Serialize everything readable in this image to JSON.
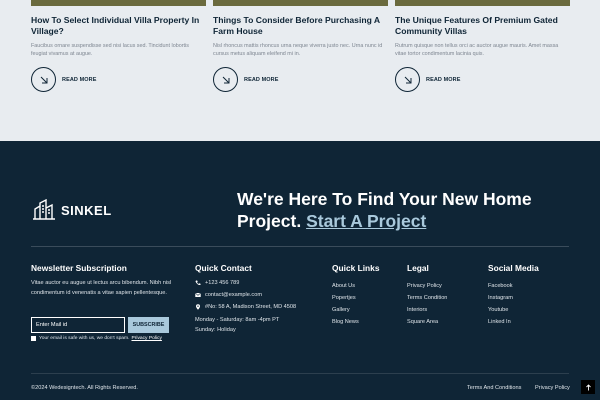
{
  "blog": {
    "cards": [
      {
        "title": "How To Select Individual Villa Property In Village?",
        "desc": "Faucibus ornare suspendisse sed nisi lacus sed. Tincidunt lobortis feugiat vivamus at augue.",
        "more": "READ MORE"
      },
      {
        "title": "Things To Consider Before Purchasing A Farm House",
        "desc": "Nisl rhoncus mattis rhoncus urna neque viverra justo nec. Urna nunc id cursus metus aliquam eleifend mi in.",
        "more": "READ MORE"
      },
      {
        "title": "The Unique Features Of Premium Gated Community Villas",
        "desc": "Rutrum quisque non tellus orci ac auctor augue mauris. Amet massa vitae tortor condimentum lacinia quis.",
        "more": "READ MORE"
      }
    ]
  },
  "footer": {
    "logo": "SINKEL",
    "hero_line1": "We're Here To Find Your New Home",
    "hero_line2": "Project.",
    "hero_cta": "Start A Project",
    "newsletter": {
      "title": "Newsletter Subscription",
      "text": "Vitae auctor eu augue ut lectus arcu bibendum. Nibh nisl condimentum id venenatis a vitae sapien pellentesque.",
      "placeholder": "Enter Mail id",
      "button": "SUBSCRIBE",
      "consent": "Your email is safe with us, we don't spam.",
      "privacy_link": "Privacy Policy"
    },
    "contact": {
      "title": "Quick Contact",
      "phone": "+123 456 789",
      "email": "contact@example.com",
      "address": "#No: 58 A, Madison Street, MD 4508",
      "hours_line1": "Monday - Saturday: 8am -4pm PT",
      "hours_line2": "Sunday: Holiday"
    },
    "quick_links": {
      "title": "Quick Links",
      "items": [
        "About Us",
        "Popertjes",
        "Gallery",
        "Blog News"
      ]
    },
    "legal": {
      "title": "Legal",
      "items": [
        "Privacy Policy",
        "Terms Condition",
        "Interiors",
        "Square Area"
      ]
    },
    "social": {
      "title": "Social Media",
      "items": [
        "Facebook",
        "Instagram",
        "Youtube",
        "Linked In"
      ]
    },
    "copyright": "©2024 Wedesigntech. All Rights Reserved.",
    "terms": "Terms And Conditions",
    "privacy": "Privacy Policy"
  },
  "colors": {
    "footer_bg": "#0f2536",
    "accent": "#a9c9dc",
    "blog_bg": "#e8ecf0"
  }
}
